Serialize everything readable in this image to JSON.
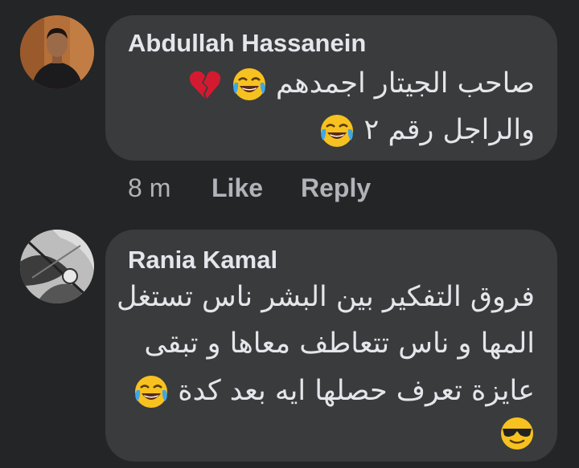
{
  "comments": [
    {
      "author": "Abdullah Hassanein",
      "lines": [
        "صاحب الجيتار اجمدهم",
        "والراجل رقم ٢"
      ],
      "actions": {
        "time": "8 m",
        "like": "Like",
        "reply": "Reply"
      }
    },
    {
      "author": "Rania Kamal",
      "lines": [
        "فروق التفكير بين البشر ناس تستغل",
        "المها و ناس تتعاطف معاها و تبقى",
        "عايزة تعرف حصلها ايه بعد كدة"
      ]
    }
  ],
  "icons": {
    "joy": "face-with-tears-of-joy-icon",
    "broken_heart": "broken-heart-icon",
    "sunglasses": "smiling-face-with-sunglasses-icon"
  },
  "colors": {
    "background": "#242526",
    "bubble": "#3a3b3c",
    "text": "#e4e6eb",
    "meta": "#b0b3b8"
  }
}
